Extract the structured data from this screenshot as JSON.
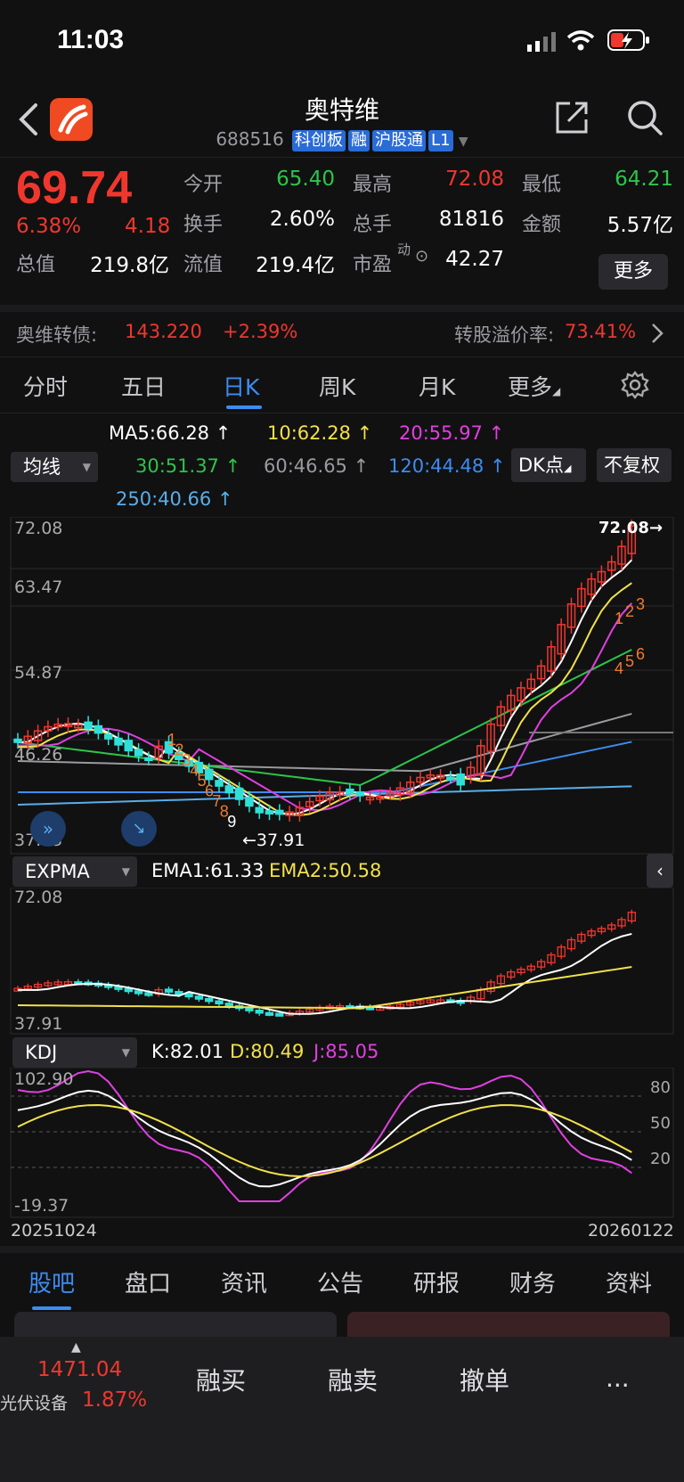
{
  "status_bar": {
    "time": "11:03"
  },
  "header": {
    "name": "奥特维",
    "code": "688516",
    "tags": [
      "科创板",
      "融",
      "沪股通",
      "L1"
    ]
  },
  "quote": {
    "price": "69.74",
    "change_pct": "6.38%",
    "change": "4.18",
    "open_label": "今开",
    "open": "65.40",
    "high_label": "最高",
    "high": "72.08",
    "low_label": "最低",
    "low": "64.21",
    "turnover_label": "换手",
    "turnover": "2.60%",
    "volume_label": "总手",
    "volume": "81816",
    "amount_label": "金额",
    "amount": "5.57亿",
    "mktcap_label": "总值",
    "mktcap": "219.8亿",
    "float_label": "流值",
    "float": "219.4亿",
    "pe_label": "市盈",
    "pe_sup": "动",
    "pe": "42.27",
    "more": "更多"
  },
  "bond": {
    "name": "奥维转债:",
    "price": "143.220",
    "change": "+2.39%",
    "premium_label": "转股溢价率:",
    "premium": "73.41%"
  },
  "kline_tabs": [
    "分时",
    "五日",
    "日K",
    "周K",
    "月K",
    "更多"
  ],
  "ma_header": {
    "selector": "均线",
    "ma5": "MA5:66.28 ↑",
    "ma10": "10:62.28 ↑",
    "ma20": "20:55.97 ↑",
    "ma30": "30:51.37 ↑",
    "ma60": "60:46.65 ↑",
    "ma120": "120:44.48 ↑",
    "ma250": "250:40.66 ↑",
    "dk_button": "DK点",
    "fq_button": "不复权"
  },
  "main_chart": {
    "y_labels": [
      "72.08",
      "63.47",
      "54.87",
      "46.26",
      "37.65"
    ],
    "high_label": "72.08",
    "low_label": "37.91",
    "signal_numbers": [
      "1",
      "2",
      "3",
      "4",
      "5",
      "6",
      "7",
      "8",
      "9"
    ],
    "top_signals": [
      "1",
      "2",
      "3",
      "4",
      "5",
      "6"
    ]
  },
  "expma": {
    "selector": "EXPMA",
    "ema1": "EMA1:61.33",
    "ema2": "EMA2:50.58",
    "y_top": "72.08",
    "y_bottom": "37.91"
  },
  "kdj": {
    "selector": "KDJ",
    "k": "K:82.01",
    "d": "D:80.49",
    "j": "J:85.05",
    "y_top": "102.90",
    "y_bottom": "-19.37",
    "levels": [
      "80",
      "50",
      "20"
    ],
    "date_start": "20251024",
    "date_end": "20260122"
  },
  "bottom_tabs": [
    "股吧",
    "盘口",
    "资讯",
    "公告",
    "研报",
    "财务",
    "资料"
  ],
  "bottom_bar": {
    "index_value": "1471.04",
    "index_name": "光伏设备",
    "index_change": "1.87%",
    "buttons": [
      "融买",
      "融卖",
      "撤单",
      "..."
    ]
  },
  "colors": {
    "up": "#f0372e",
    "down": "#2fe0d8",
    "ma5": "#ffffff",
    "ma10": "#f2e14a",
    "ma20": "#e040e0",
    "ma30": "#2dc54a",
    "ma60": "#9a9aa0",
    "ma120": "#3d8cf0",
    "ma250": "#5aaee8",
    "accent": "#3d8cf0"
  }
}
